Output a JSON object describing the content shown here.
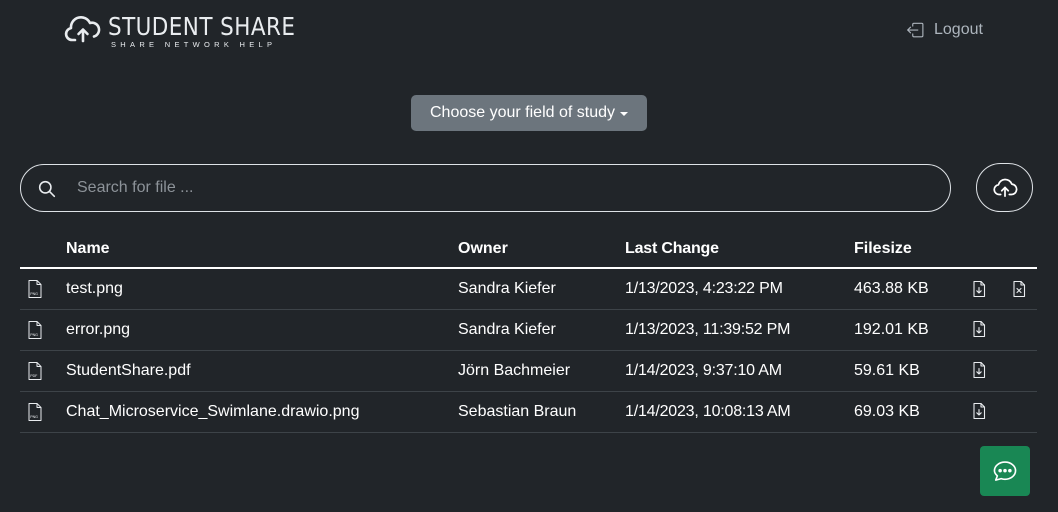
{
  "header": {
    "logo_title": "STUDENT SHARE",
    "logo_subtitle": "SHARE NETWORK HELP",
    "logout_label": "Logout"
  },
  "field_dropdown": {
    "label": "Choose your field of study"
  },
  "search": {
    "placeholder": "Search for file ..."
  },
  "table": {
    "headers": {
      "name": "Name",
      "owner": "Owner",
      "last_change": "Last Change",
      "filesize": "Filesize"
    },
    "rows": [
      {
        "type": "PNG",
        "name": "test.png",
        "owner": "Sandra Kiefer",
        "last_change": "1/13/2023, 4:23:22 PM",
        "filesize": "463.88 KB",
        "deletable": true
      },
      {
        "type": "PNG",
        "name": "error.png",
        "owner": "Sandra Kiefer",
        "last_change": "1/13/2023, 11:39:52 PM",
        "filesize": "192.01 KB",
        "deletable": false
      },
      {
        "type": "PDF",
        "name": "StudentShare.pdf",
        "owner": "Jörn Bachmeier",
        "last_change": "1/14/2023, 9:37:10 AM",
        "filesize": "59.61 KB",
        "deletable": false
      },
      {
        "type": "PNG",
        "name": "Chat_Microservice_Swimlane.drawio.png",
        "owner": "Sebastian Braun",
        "last_change": "1/14/2023, 10:08:13 AM",
        "filesize": "69.03 KB",
        "deletable": false
      }
    ]
  },
  "icons": {
    "logo": "cloud-upload-icon",
    "logout": "box-arrow-in-left-icon",
    "search": "search-icon",
    "upload": "cloud-upload-icon",
    "file": "file-type-icon",
    "download": "file-download-icon",
    "delete": "file-delete-icon",
    "chat": "chat-dots-icon"
  },
  "colors": {
    "background": "#212529",
    "dropdown": "#6c757d",
    "chat_button": "#198754",
    "text": "#ffffff"
  }
}
